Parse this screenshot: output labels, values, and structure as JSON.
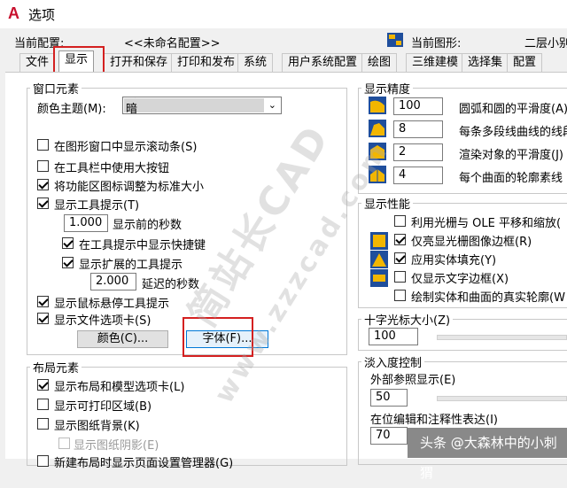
{
  "window": {
    "title": "选项",
    "app_icon_letter": "A"
  },
  "header": {
    "config_label": "当前配置:",
    "config_value": "<<未命名配置>>",
    "drawing_label": "当前图形:",
    "drawing_value": "二层小别"
  },
  "tabs": [
    "文件",
    "显示",
    "打开和保存",
    "打印和发布",
    "系统",
    "用户系统配置",
    "绘图",
    "三维建模",
    "选择集",
    "配置"
  ],
  "active_tab": "显示",
  "window_elements": {
    "title": "窗口元素",
    "color_theme_label": "颜色主题(M):",
    "color_theme_value": "暗",
    "options": [
      {
        "label": "在图形窗口中显示滚动条(S)",
        "checked": false
      },
      {
        "label": "在工具栏中使用大按钮",
        "checked": false
      },
      {
        "label": "将功能区图标调整为标准大小",
        "checked": true
      },
      {
        "label": "显示工具提示(T)",
        "checked": true
      }
    ],
    "tooltip_delay_value": "1.000",
    "tooltip_delay_label": "显示前的秒数",
    "show_shortcut_label": "在工具提示中显示快捷键",
    "show_extended_label": "显示扩展的工具提示",
    "extended_delay_value": "2.000",
    "extended_delay_label": "延迟的秒数",
    "rollover_label": "显示鼠标悬停工具提示",
    "file_tabs_label": "显示文件选项卡(S)",
    "colors_button": "颜色(C)...",
    "fonts_button": "字体(F)..."
  },
  "layout_elements": {
    "title": "布局元素",
    "options": [
      {
        "label": "显示布局和模型选项卡(L)",
        "checked": true
      },
      {
        "label": "显示可打印区域(B)",
        "checked": false
      },
      {
        "label": "显示图纸背景(K)",
        "checked": false
      }
    ],
    "shadow_label": "显示图纸阴影(E)",
    "partial_label": "新建布局时显示页面设置管理器(G)"
  },
  "display_resolution": {
    "title": "显示精度",
    "rows": [
      {
        "value": "100",
        "label": "圆弧和圆的平滑度(A)"
      },
      {
        "value": "8",
        "label": "每条多段线曲线的线段数"
      },
      {
        "value": "2",
        "label": "渲染对象的平滑度(J)"
      },
      {
        "value": "4",
        "label": "每个曲面的轮廓素线"
      }
    ]
  },
  "display_performance": {
    "title": "显示性能",
    "options": [
      {
        "label": "利用光栅与 OLE 平移和缩放(",
        "checked": false
      },
      {
        "label": "仅亮显光栅图像边框(R)",
        "checked": true
      },
      {
        "label": "应用实体填充(Y)",
        "checked": true
      },
      {
        "label": "仅显示文字边框(X)",
        "checked": false
      },
      {
        "label": "绘制实体和曲面的真实轮廓(W",
        "checked": false
      }
    ]
  },
  "crosshair": {
    "title": "十字光标大小(Z)",
    "value": "100"
  },
  "fade_control": {
    "title": "淡入度控制",
    "xref_label": "外部参照显示(E)",
    "xref_value": "50",
    "inplace_label": "在位编辑和注释性表达(I)",
    "inplace_value": "70"
  },
  "watermarks": {
    "diag": "简站长CAD",
    "url": "www.zzzcad.com"
  },
  "badge_text": "头条 @大森林中的小刺猬",
  "colors": {
    "accent_red": "#d42020",
    "icon_blue": "#1f4e9c",
    "icon_yellow": "#f2b600"
  }
}
